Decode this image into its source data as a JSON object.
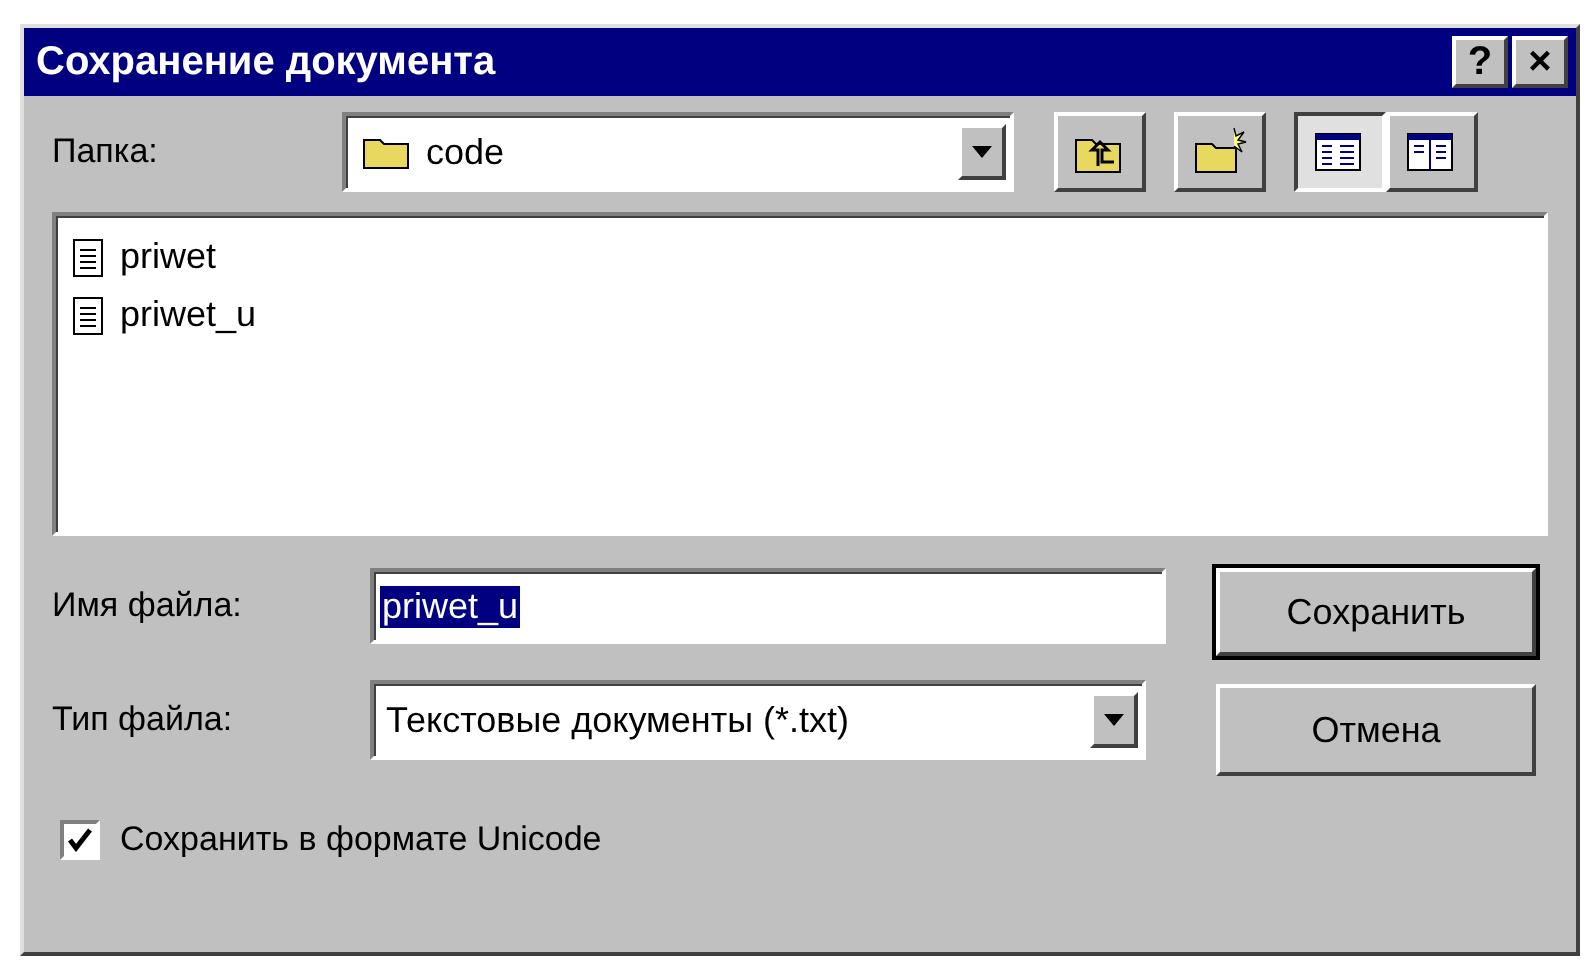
{
  "window": {
    "title": "Сохранение документа",
    "title_buttons": [
      "?",
      "×"
    ]
  },
  "folder": {
    "label": "Папка:",
    "value": "code"
  },
  "toolbar": [
    {
      "kind": "up"
    },
    {
      "kind": "new-folder"
    },
    {
      "kind": "list-view",
      "selected": true
    },
    {
      "kind": "details-view",
      "selected": false
    }
  ],
  "files": [
    {
      "name": "priwet"
    },
    {
      "name": "priwet_u"
    }
  ],
  "file_name": {
    "label": "Имя файла:",
    "value": "priwet_u",
    "selected_text": true
  },
  "file_type": {
    "label": "Тип файла:",
    "value": "Текстовые документы (*.txt)"
  },
  "unicode": {
    "label": "Сохранить в формате Unicode",
    "checked": true
  },
  "buttons": [
    {
      "label": "Сохранить",
      "default": true
    },
    {
      "label": "Отмена",
      "default": false
    }
  ]
}
